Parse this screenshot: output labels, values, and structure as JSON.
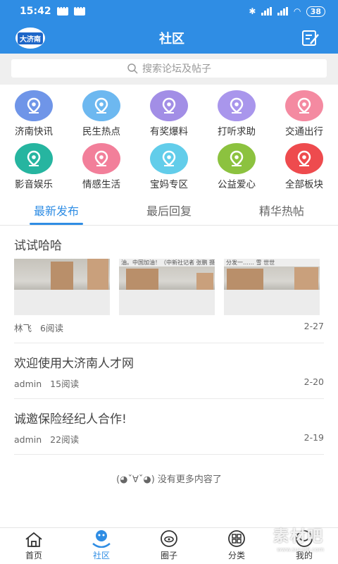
{
  "status": {
    "time": "15:42",
    "battery": "38"
  },
  "header": {
    "logo_text": "大济南",
    "title": "社区"
  },
  "search": {
    "placeholder": "搜索论坛及帖子"
  },
  "categories": [
    {
      "label": "济南快讯",
      "color": "#6f95e8"
    },
    {
      "label": "民生热点",
      "color": "#6db8f0"
    },
    {
      "label": "有奖爆料",
      "color": "#a28ee6"
    },
    {
      "label": "打听求助",
      "color": "#a996ec"
    },
    {
      "label": "交通出行",
      "color": "#f48aa1"
    },
    {
      "label": "影音娱乐",
      "color": "#26b5a0"
    },
    {
      "label": "情感生活",
      "color": "#f27f9a"
    },
    {
      "label": "宝妈专区",
      "color": "#62cdea"
    },
    {
      "label": "公益爱心",
      "color": "#8cc23f"
    },
    {
      "label": "全部板块",
      "color": "#ee4b4e"
    }
  ],
  "tabs": [
    "最新发布",
    "最后回复",
    "精华热帖"
  ],
  "posts": [
    {
      "title": "试试哈哈",
      "author": "林飞",
      "reads": "6阅读",
      "date": "2-27",
      "captions": [
        "",
        "油。中国加油！（中新社记者 张鹏 摄）",
        "分发一…… 雪 世世"
      ]
    },
    {
      "title": "欢迎使用大济南人才网",
      "author": "admin",
      "reads": "15阅读",
      "date": "2-20"
    },
    {
      "title": "诚邀保险经纪人合作!",
      "author": "admin",
      "reads": "22阅读",
      "date": "2-19"
    }
  ],
  "end_text": "(◕ˇ∀ˇ◕) 没有更多内容了",
  "tabbar": [
    {
      "label": "首页",
      "icon": "home-icon"
    },
    {
      "label": "社区",
      "icon": "community-icon"
    },
    {
      "label": "圈子",
      "icon": "circle-icon"
    },
    {
      "label": "分类",
      "icon": "category-icon"
    },
    {
      "label": "我的",
      "icon": "profile-icon"
    }
  ],
  "watermark": {
    "text": "素材吧",
    "url": "www.sucai8.com"
  },
  "colors": {
    "primary": "#2f8de4",
    "search_bg": "#efefef"
  }
}
